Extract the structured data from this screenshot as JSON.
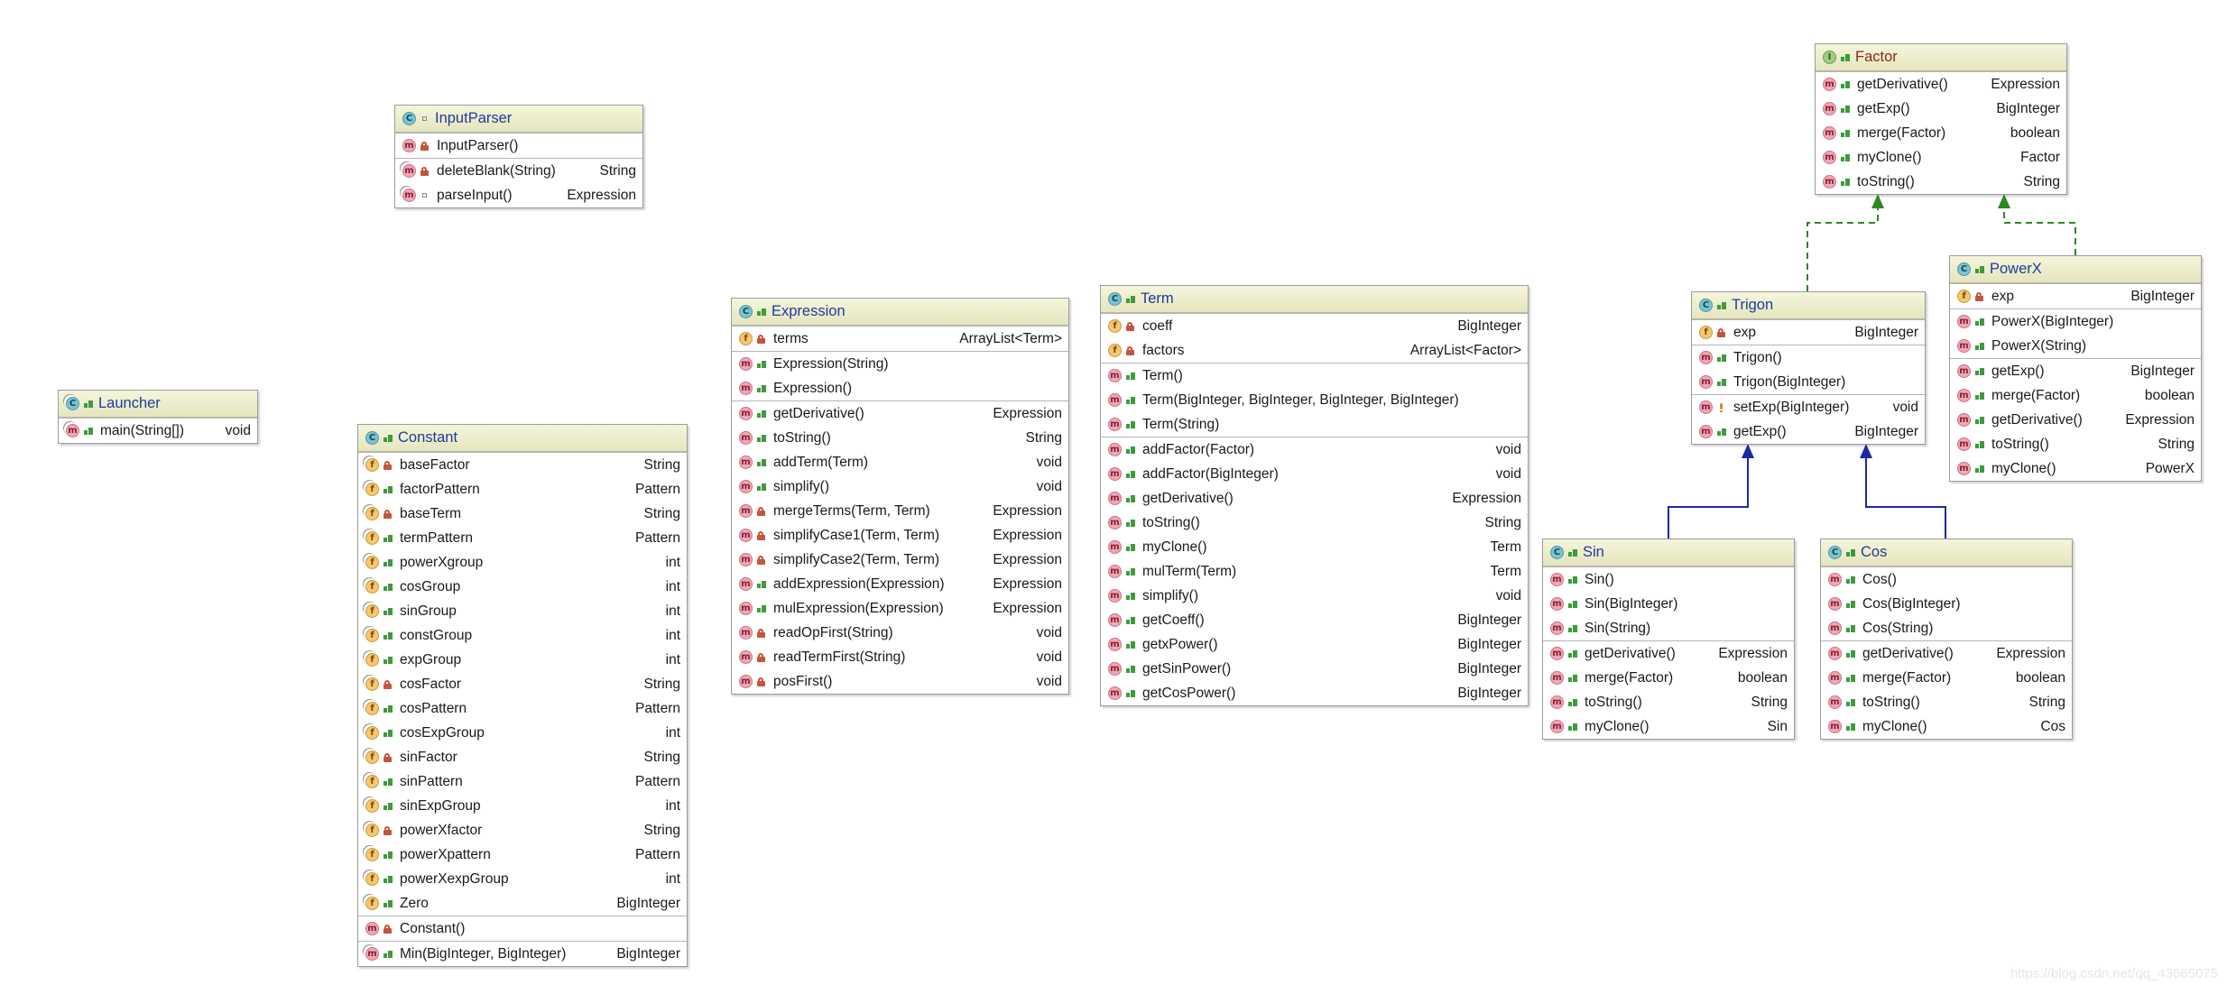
{
  "diagram": {
    "classes": [
      {
        "id": "factor",
        "name": "Factor",
        "kind": "interface",
        "sections": [
          [
            {
              "kind": "method",
              "vis": "public",
              "sig": "getDerivative()",
              "type": "Expression"
            },
            {
              "kind": "method",
              "vis": "public",
              "sig": "getExp()",
              "type": "BigInteger"
            },
            {
              "kind": "method",
              "vis": "public",
              "sig": "merge(Factor)",
              "type": "boolean"
            },
            {
              "kind": "method",
              "vis": "public",
              "sig": "myClone()",
              "type": "Factor"
            },
            {
              "kind": "method",
              "vis": "public",
              "sig": "toString()",
              "type": "String"
            }
          ]
        ]
      },
      {
        "id": "inputparser",
        "name": "InputParser",
        "kind": "class",
        "vis": "package",
        "sections": [
          [
            {
              "kind": "method",
              "vis": "private",
              "sig": "InputParser()",
              "type": ""
            }
          ],
          [
            {
              "kind": "method",
              "vis": "private",
              "static": true,
              "sig": "deleteBlank(String)",
              "type": "String"
            },
            {
              "kind": "method",
              "vis": "package",
              "static": true,
              "sig": "parseInput()",
              "type": "Expression"
            }
          ]
        ]
      },
      {
        "id": "launcher",
        "name": "Launcher",
        "kind": "class",
        "vis": "public",
        "static_badge": true,
        "sections": [
          [
            {
              "kind": "method",
              "vis": "public",
              "static": true,
              "sig": "main(String[])",
              "type": "void"
            }
          ]
        ]
      },
      {
        "id": "constant",
        "name": "Constant",
        "kind": "class",
        "vis": "public",
        "sections": [
          [
            {
              "kind": "field",
              "vis": "private",
              "static": true,
              "sig": "baseFactor",
              "type": "String"
            },
            {
              "kind": "field",
              "vis": "public",
              "static": true,
              "sig": "factorPattern",
              "type": "Pattern"
            },
            {
              "kind": "field",
              "vis": "private",
              "static": true,
              "sig": "baseTerm",
              "type": "String"
            },
            {
              "kind": "field",
              "vis": "public",
              "static": true,
              "sig": "termPattern",
              "type": "Pattern"
            },
            {
              "kind": "field",
              "vis": "public",
              "static": true,
              "sig": "powerXgroup",
              "type": "int"
            },
            {
              "kind": "field",
              "vis": "public",
              "static": true,
              "sig": "cosGroup",
              "type": "int"
            },
            {
              "kind": "field",
              "vis": "public",
              "static": true,
              "sig": "sinGroup",
              "type": "int"
            },
            {
              "kind": "field",
              "vis": "public",
              "static": true,
              "sig": "constGroup",
              "type": "int"
            },
            {
              "kind": "field",
              "vis": "public",
              "static": true,
              "sig": "expGroup",
              "type": "int"
            },
            {
              "kind": "field",
              "vis": "private",
              "static": true,
              "sig": "cosFactor",
              "type": "String"
            },
            {
              "kind": "field",
              "vis": "public",
              "static": true,
              "sig": "cosPattern",
              "type": "Pattern"
            },
            {
              "kind": "field",
              "vis": "public",
              "static": true,
              "sig": "cosExpGroup",
              "type": "int"
            },
            {
              "kind": "field",
              "vis": "private",
              "static": true,
              "sig": "sinFactor",
              "type": "String"
            },
            {
              "kind": "field",
              "vis": "public",
              "static": true,
              "sig": "sinPattern",
              "type": "Pattern"
            },
            {
              "kind": "field",
              "vis": "public",
              "static": true,
              "sig": "sinExpGroup",
              "type": "int"
            },
            {
              "kind": "field",
              "vis": "private",
              "static": true,
              "sig": "powerXfactor",
              "type": "String"
            },
            {
              "kind": "field",
              "vis": "public",
              "static": true,
              "sig": "powerXpattern",
              "type": "Pattern"
            },
            {
              "kind": "field",
              "vis": "public",
              "static": true,
              "sig": "powerXexpGroup",
              "type": "int"
            },
            {
              "kind": "field",
              "vis": "public",
              "static": true,
              "sig": "Zero",
              "type": "BigInteger"
            }
          ],
          [
            {
              "kind": "method",
              "vis": "private",
              "sig": "Constant()",
              "type": ""
            }
          ],
          [
            {
              "kind": "method",
              "vis": "public",
              "static": true,
              "sig": "Min(BigInteger, BigInteger)",
              "type": "BigInteger"
            }
          ]
        ]
      },
      {
        "id": "expression",
        "name": "Expression",
        "kind": "class",
        "vis": "public",
        "sections": [
          [
            {
              "kind": "field",
              "vis": "private",
              "sig": "terms",
              "type": "ArrayList<Term>"
            }
          ],
          [
            {
              "kind": "method",
              "vis": "public",
              "sig": "Expression(String)",
              "type": ""
            },
            {
              "kind": "method",
              "vis": "public",
              "sig": "Expression()",
              "type": ""
            }
          ],
          [
            {
              "kind": "method",
              "vis": "public",
              "sig": "getDerivative()",
              "type": "Expression"
            },
            {
              "kind": "method",
              "vis": "public",
              "sig": "toString()",
              "type": "String"
            },
            {
              "kind": "method",
              "vis": "public",
              "sig": "addTerm(Term)",
              "type": "void"
            },
            {
              "kind": "method",
              "vis": "public",
              "sig": "simplify()",
              "type": "void"
            },
            {
              "kind": "method",
              "vis": "private",
              "sig": "mergeTerms(Term, Term)",
              "type": "Expression"
            },
            {
              "kind": "method",
              "vis": "private",
              "sig": "simplifyCase1(Term, Term)",
              "type": "Expression"
            },
            {
              "kind": "method",
              "vis": "private",
              "sig": "simplifyCase2(Term, Term)",
              "type": "Expression"
            },
            {
              "kind": "method",
              "vis": "public",
              "sig": "addExpression(Expression)",
              "type": "Expression"
            },
            {
              "kind": "method",
              "vis": "public",
              "sig": "mulExpression(Expression)",
              "type": "Expression"
            },
            {
              "kind": "method",
              "vis": "private",
              "sig": "readOpFirst(String)",
              "type": "void"
            },
            {
              "kind": "method",
              "vis": "private",
              "sig": "readTermFirst(String)",
              "type": "void"
            },
            {
              "kind": "method",
              "vis": "private",
              "sig": "posFirst()",
              "type": "void"
            }
          ]
        ]
      },
      {
        "id": "term",
        "name": "Term",
        "kind": "class",
        "vis": "public",
        "sections": [
          [
            {
              "kind": "field",
              "vis": "private",
              "sig": "coeff",
              "type": "BigInteger"
            },
            {
              "kind": "field",
              "vis": "private",
              "sig": "factors",
              "type": "ArrayList<Factor>"
            }
          ],
          [
            {
              "kind": "method",
              "vis": "public",
              "sig": "Term()",
              "type": ""
            },
            {
              "kind": "method",
              "vis": "public",
              "sig": "Term(BigInteger, BigInteger, BigInteger, BigInteger)",
              "type": ""
            },
            {
              "kind": "method",
              "vis": "public",
              "sig": "Term(String)",
              "type": ""
            }
          ],
          [
            {
              "kind": "method",
              "vis": "public",
              "sig": "addFactor(Factor)",
              "type": "void"
            },
            {
              "kind": "method",
              "vis": "public",
              "sig": "addFactor(BigInteger)",
              "type": "void"
            },
            {
              "kind": "method",
              "vis": "public",
              "sig": "getDerivative()",
              "type": "Expression"
            },
            {
              "kind": "method",
              "vis": "public",
              "sig": "toString()",
              "type": "String"
            },
            {
              "kind": "method",
              "vis": "public",
              "sig": "myClone()",
              "type": "Term"
            },
            {
              "kind": "method",
              "vis": "public",
              "sig": "mulTerm(Term)",
              "type": "Term"
            },
            {
              "kind": "method",
              "vis": "public",
              "sig": "simplify()",
              "type": "void"
            },
            {
              "kind": "method",
              "vis": "public",
              "sig": "getCoeff()",
              "type": "BigInteger"
            },
            {
              "kind": "method",
              "vis": "public",
              "sig": "getxPower()",
              "type": "BigInteger"
            },
            {
              "kind": "method",
              "vis": "public",
              "sig": "getSinPower()",
              "type": "BigInteger"
            },
            {
              "kind": "method",
              "vis": "public",
              "sig": "getCosPower()",
              "type": "BigInteger"
            }
          ]
        ]
      },
      {
        "id": "trigon",
        "name": "Trigon",
        "kind": "class",
        "vis": "public",
        "sections": [
          [
            {
              "kind": "field",
              "vis": "private",
              "sig": "exp",
              "type": "BigInteger"
            }
          ],
          [
            {
              "kind": "method",
              "vis": "public",
              "sig": "Trigon()",
              "type": ""
            },
            {
              "kind": "method",
              "vis": "public",
              "sig": "Trigon(BigInteger)",
              "type": ""
            }
          ],
          [
            {
              "kind": "method",
              "vis": "protected",
              "sig": "setExp(BigInteger)",
              "type": "void"
            },
            {
              "kind": "method",
              "vis": "public",
              "sig": "getExp()",
              "type": "BigInteger"
            }
          ]
        ]
      },
      {
        "id": "powerx",
        "name": "PowerX",
        "kind": "class",
        "vis": "public",
        "sections": [
          [
            {
              "kind": "field",
              "vis": "private",
              "sig": "exp",
              "type": "BigInteger"
            }
          ],
          [
            {
              "kind": "method",
              "vis": "public",
              "sig": "PowerX(BigInteger)",
              "type": ""
            },
            {
              "kind": "method",
              "vis": "public",
              "sig": "PowerX(String)",
              "type": ""
            }
          ],
          [
            {
              "kind": "method",
              "vis": "public",
              "sig": "getExp()",
              "type": "BigInteger"
            },
            {
              "kind": "method",
              "vis": "public",
              "sig": "merge(Factor)",
              "type": "boolean"
            },
            {
              "kind": "method",
              "vis": "public",
              "sig": "getDerivative()",
              "type": "Expression"
            },
            {
              "kind": "method",
              "vis": "public",
              "sig": "toString()",
              "type": "String"
            },
            {
              "kind": "method",
              "vis": "public",
              "sig": "myClone()",
              "type": "PowerX"
            }
          ]
        ]
      },
      {
        "id": "sin",
        "name": "Sin",
        "kind": "class",
        "vis": "public",
        "sections": [
          [
            {
              "kind": "method",
              "vis": "public",
              "sig": "Sin()",
              "type": ""
            },
            {
              "kind": "method",
              "vis": "public",
              "sig": "Sin(BigInteger)",
              "type": ""
            },
            {
              "kind": "method",
              "vis": "public",
              "sig": "Sin(String)",
              "type": ""
            }
          ],
          [
            {
              "kind": "method",
              "vis": "public",
              "sig": "getDerivative()",
              "type": "Expression"
            },
            {
              "kind": "method",
              "vis": "public",
              "sig": "merge(Factor)",
              "type": "boolean"
            },
            {
              "kind": "method",
              "vis": "public",
              "sig": "toString()",
              "type": "String"
            },
            {
              "kind": "method",
              "vis": "public",
              "sig": "myClone()",
              "type": "Sin"
            }
          ]
        ]
      },
      {
        "id": "cos",
        "name": "Cos",
        "kind": "class",
        "vis": "public",
        "sections": [
          [
            {
              "kind": "method",
              "vis": "public",
              "sig": "Cos()",
              "type": ""
            },
            {
              "kind": "method",
              "vis": "public",
              "sig": "Cos(BigInteger)",
              "type": ""
            },
            {
              "kind": "method",
              "vis": "public",
              "sig": "Cos(String)",
              "type": ""
            }
          ],
          [
            {
              "kind": "method",
              "vis": "public",
              "sig": "getDerivative()",
              "type": "Expression"
            },
            {
              "kind": "method",
              "vis": "public",
              "sig": "merge(Factor)",
              "type": "boolean"
            },
            {
              "kind": "method",
              "vis": "public",
              "sig": "toString()",
              "type": "String"
            },
            {
              "kind": "method",
              "vis": "public",
              "sig": "myClone()",
              "type": "Cos"
            }
          ]
        ]
      }
    ],
    "relations": [
      {
        "from": "trigon",
        "to": "factor",
        "type": "realization"
      },
      {
        "from": "powerx",
        "to": "factor",
        "type": "realization"
      },
      {
        "from": "sin",
        "to": "trigon",
        "type": "generalization"
      },
      {
        "from": "cos",
        "to": "trigon",
        "type": "generalization"
      }
    ],
    "colors": {
      "realization": "#2b8a1d",
      "generalization": "#1a28a8",
      "class_name": "#1f3c9a",
      "interface_name": "#8a2c1a"
    },
    "watermark": "https://blog.csdn.net/qq_43665075"
  }
}
